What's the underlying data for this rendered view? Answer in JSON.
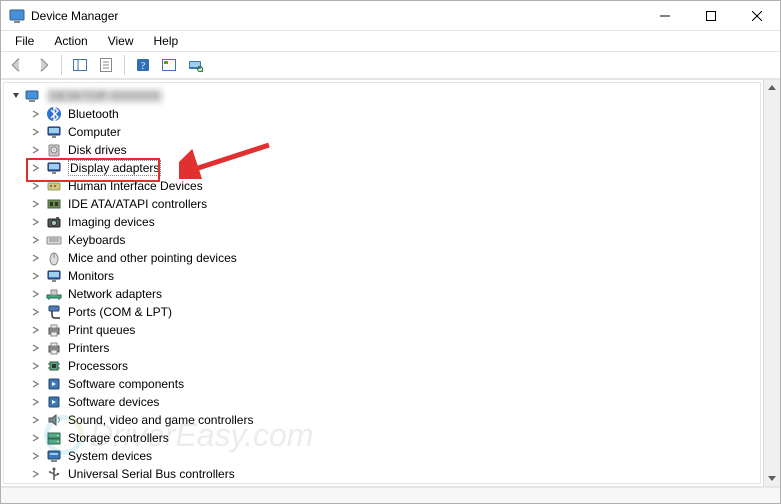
{
  "window": {
    "title": "Device Manager"
  },
  "menu": {
    "file": "File",
    "action": "Action",
    "view": "View",
    "help": "Help"
  },
  "tree": {
    "root": "DESKTOP-XXXXXX",
    "items": [
      {
        "label": "Bluetooth",
        "icon": "bluetooth"
      },
      {
        "label": "Computer",
        "icon": "monitor"
      },
      {
        "label": "Disk drives",
        "icon": "disk"
      },
      {
        "label": "Display adapters",
        "icon": "monitor",
        "highlighted": true
      },
      {
        "label": "Human Interface Devices",
        "icon": "hid"
      },
      {
        "label": "IDE ATA/ATAPI controllers",
        "icon": "ide"
      },
      {
        "label": "Imaging devices",
        "icon": "imaging"
      },
      {
        "label": "Keyboards",
        "icon": "keyboard"
      },
      {
        "label": "Mice and other pointing devices",
        "icon": "mouse"
      },
      {
        "label": "Monitors",
        "icon": "monitor"
      },
      {
        "label": "Network adapters",
        "icon": "network"
      },
      {
        "label": "Ports (COM & LPT)",
        "icon": "port"
      },
      {
        "label": "Print queues",
        "icon": "printer"
      },
      {
        "label": "Printers",
        "icon": "printer"
      },
      {
        "label": "Processors",
        "icon": "cpu"
      },
      {
        "label": "Software components",
        "icon": "software"
      },
      {
        "label": "Software devices",
        "icon": "software"
      },
      {
        "label": "Sound, video and game controllers",
        "icon": "sound"
      },
      {
        "label": "Storage controllers",
        "icon": "storage"
      },
      {
        "label": "System devices",
        "icon": "system"
      },
      {
        "label": "Universal Serial Bus controllers",
        "icon": "usb"
      }
    ]
  },
  "watermark": {
    "text": "DriverEasy.com"
  }
}
